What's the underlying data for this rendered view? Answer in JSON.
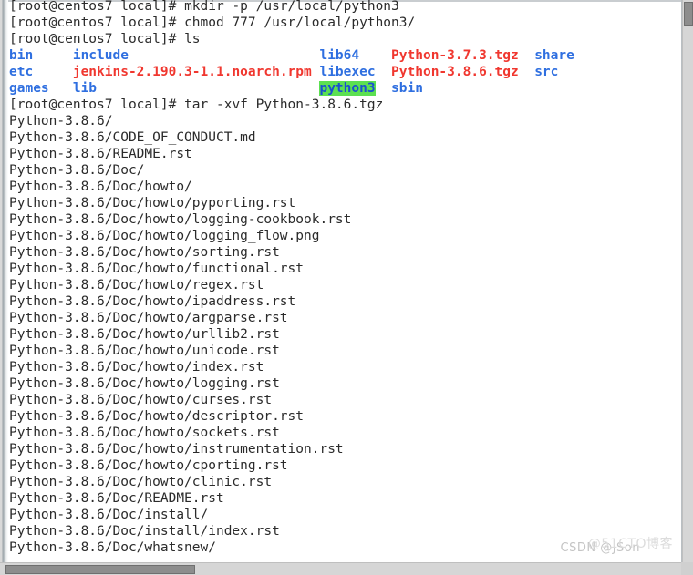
{
  "terminal": {
    "prompt": "[root@centos7 local]# ",
    "commands": {
      "mkdir": "mkdir -p /usr/local/python3",
      "chmod": "chmod 777 /usr/local/python3/",
      "ls": "ls",
      "tar": "tar -xvf Python-3.8.6.tgz"
    },
    "ls_output": {
      "columns_note": "four aligned columns from ls with color coding",
      "rows": [
        [
          {
            "text": "bin",
            "type": "dir"
          },
          {
            "text": "include",
            "type": "dir"
          },
          {
            "text": "lib64",
            "type": "dir"
          },
          {
            "text": "Python-3.7.3.tgz",
            "type": "archive"
          },
          {
            "text": "share",
            "type": "dir"
          }
        ],
        [
          {
            "text": "etc",
            "type": "dir"
          },
          {
            "text": "jenkins-2.190.3-1.1.noarch.rpm",
            "type": "archive"
          },
          {
            "text": "libexec",
            "type": "dir"
          },
          {
            "text": "Python-3.8.6.tgz",
            "type": "archive"
          },
          {
            "text": "src",
            "type": "dir"
          }
        ],
        [
          {
            "text": "games",
            "type": "dir"
          },
          {
            "text": "lib",
            "type": "dir"
          },
          {
            "text": "python3",
            "type": "sticky"
          },
          {
            "text": "sbin",
            "type": "dir"
          },
          {
            "text": "",
            "type": "plain"
          }
        ]
      ]
    },
    "tar_output": [
      "Python-3.8.6/",
      "Python-3.8.6/CODE_OF_CONDUCT.md",
      "Python-3.8.6/README.rst",
      "Python-3.8.6/Doc/",
      "Python-3.8.6/Doc/howto/",
      "Python-3.8.6/Doc/howto/pyporting.rst",
      "Python-3.8.6/Doc/howto/logging-cookbook.rst",
      "Python-3.8.6/Doc/howto/logging_flow.png",
      "Python-3.8.6/Doc/howto/sorting.rst",
      "Python-3.8.6/Doc/howto/functional.rst",
      "Python-3.8.6/Doc/howto/regex.rst",
      "Python-3.8.6/Doc/howto/ipaddress.rst",
      "Python-3.8.6/Doc/howto/argparse.rst",
      "Python-3.8.6/Doc/howto/urllib2.rst",
      "Python-3.8.6/Doc/howto/unicode.rst",
      "Python-3.8.6/Doc/howto/index.rst",
      "Python-3.8.6/Doc/howto/logging.rst",
      "Python-3.8.6/Doc/howto/curses.rst",
      "Python-3.8.6/Doc/howto/descriptor.rst",
      "Python-3.8.6/Doc/howto/sockets.rst",
      "Python-3.8.6/Doc/howto/instrumentation.rst",
      "Python-3.8.6/Doc/howto/cporting.rst",
      "Python-3.8.6/Doc/howto/clinic.rst",
      "Python-3.8.6/Doc/README.rst",
      "Python-3.8.6/Doc/install/",
      "Python-3.8.6/Doc/install/index.rst",
      "Python-3.8.6/Doc/whatsnew/"
    ]
  },
  "colors": {
    "text": "#2b2b2b",
    "directory": "#2f6fe0",
    "archive": "#f0372f",
    "sticky_bg": "#5ce051",
    "sticky_fg": "#1a4fd0",
    "background": "#ffffff"
  },
  "watermarks": {
    "csdn": "CSDN @JSon",
    "cto51": "@51CTO博客"
  }
}
